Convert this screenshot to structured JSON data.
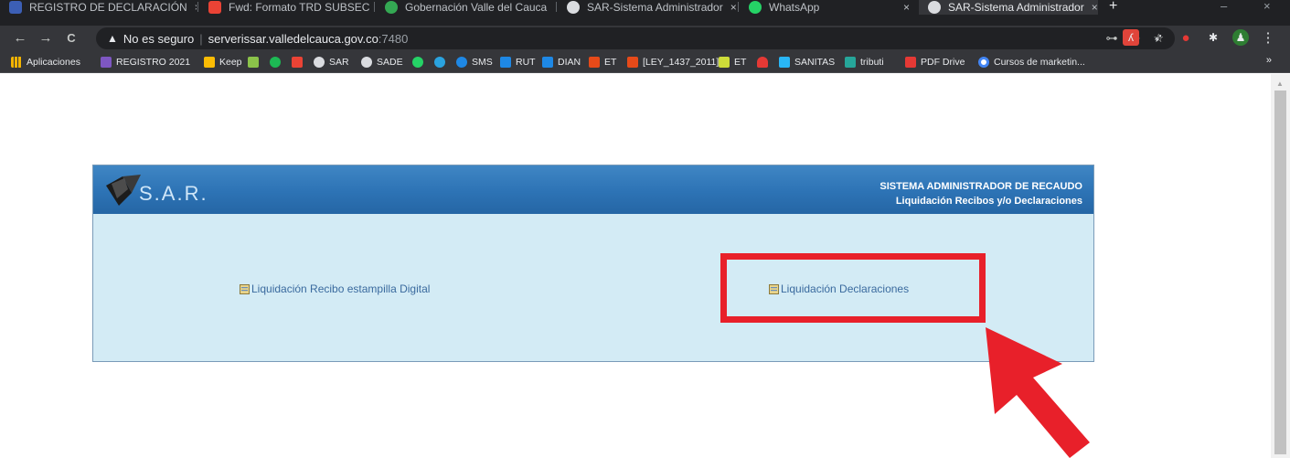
{
  "browser": {
    "tabs": [
      {
        "title": "REGISTRO DE DECLARACIÓN",
        "close": "×",
        "color": "#3c5fb5"
      },
      {
        "title": "Fwd: Formato TRD SUBSEC",
        "close": "×",
        "color": "#ea4335"
      },
      {
        "title": "Gobernación Valle del Cauca",
        "close": "×",
        "color": "#34a853"
      },
      {
        "title": "SAR-Sistema Administrador",
        "close": "×",
        "color": "#dadce0"
      },
      {
        "title": "WhatsApp",
        "close": "×",
        "color": "#25d366"
      },
      {
        "title": "SAR-Sistema Administrador",
        "close": "×",
        "color": "#dadce0"
      }
    ],
    "new_tab": "+",
    "window_controls": {
      "minimize": "–",
      "close": "×"
    },
    "nav": {
      "back": "←",
      "forward": "→",
      "reload": "C"
    },
    "address": {
      "warning_icon": "▲",
      "security_text": "No es seguro",
      "separator": "|",
      "host": "serverissar.valledelcauca.gov.co",
      "port": ":7480"
    },
    "omnibox_icons": {
      "key": "⊶",
      "zoom": "⊖",
      "star": "☆"
    },
    "extension_icons": [
      {
        "name": "pdf-extension-icon",
        "color": "#e0443a",
        "glyph": "ʎ"
      },
      {
        "name": "dart-extension-icon",
        "color": "#35363a",
        "glyph": "➶"
      },
      {
        "name": "adblock-extension-icon",
        "color": "#e53935",
        "glyph": "●"
      },
      {
        "name": "puzzle-extension-icon",
        "color": "#35363a",
        "glyph": "✱"
      },
      {
        "name": "profile-avatar-icon",
        "color": "#2e7d32",
        "glyph": "♟"
      },
      {
        "name": "menu-kebab-icon",
        "color": "#35363a",
        "glyph": "⋮"
      }
    ],
    "bookmarks": [
      {
        "label": "Aplicaciones",
        "icon": "apps-grid-icon",
        "color": "#f4b400"
      },
      {
        "label": "REGISTRO 2021",
        "icon": "forms-icon",
        "color": "#7e57c2"
      },
      {
        "label": "Keep",
        "icon": "keep-icon",
        "color": "#fbbc04"
      },
      {
        "label": "",
        "icon": "colors-icon",
        "color": "#8bc34a"
      },
      {
        "label": "",
        "icon": "spotify-icon",
        "color": "#1db954"
      },
      {
        "label": "",
        "icon": "gmail-icon",
        "color": "#ea4335"
      },
      {
        "label": "SAR",
        "icon": "globe-icon",
        "color": "#dadce0"
      },
      {
        "label": "SADE",
        "icon": "globe-icon",
        "color": "#dadce0"
      },
      {
        "label": "",
        "icon": "whatsapp-icon",
        "color": "#25d366"
      },
      {
        "label": "",
        "icon": "telegram-icon",
        "color": "#2aa3df"
      },
      {
        "label": "SMS",
        "icon": "sms-icon",
        "color": "#1e88e5"
      },
      {
        "label": "RUT",
        "icon": "rut-icon",
        "color": "#1e88e5"
      },
      {
        "label": "DIAN",
        "icon": "dian-icon",
        "color": "#1e88e5"
      },
      {
        "label": "ET",
        "icon": "et-icon",
        "color": "#e64a19"
      },
      {
        "label": "[LEY_1437_2011]",
        "icon": "ley-icon",
        "color": "#e64a19"
      },
      {
        "label": "ET",
        "icon": "font-a-icon",
        "color": "#cddc39"
      },
      {
        "label": "",
        "icon": "heart-icon",
        "color": "#e53935"
      },
      {
        "label": "SANITAS",
        "icon": "sanitas-icon",
        "color": "#29b6f6"
      },
      {
        "label": "tributi",
        "icon": "tributi-icon",
        "color": "#26a69a"
      },
      {
        "label": "PDF Drive",
        "icon": "pdfdrive-icon",
        "color": "#e53935"
      },
      {
        "label": "Cursos de marketin...",
        "icon": "google-icon",
        "color": "#ffffff"
      }
    ],
    "bookmarks_more": "»"
  },
  "page": {
    "logo_text": "S.A.R.",
    "system_title": "SISTEMA ADMINISTRADOR DE RECAUDO",
    "subtitle": "Liquidación Recibos y/o Declaraciones",
    "links": [
      {
        "label": "Liquidación Recibo estampilla Digital"
      },
      {
        "label": "Liquidación Declaraciones"
      }
    ],
    "colors": {
      "header_blue": "#2d73b5",
      "panel_bg": "#d3ebf5",
      "link_blue": "#3a6a9e",
      "highlight_red": "#e8202a"
    }
  }
}
